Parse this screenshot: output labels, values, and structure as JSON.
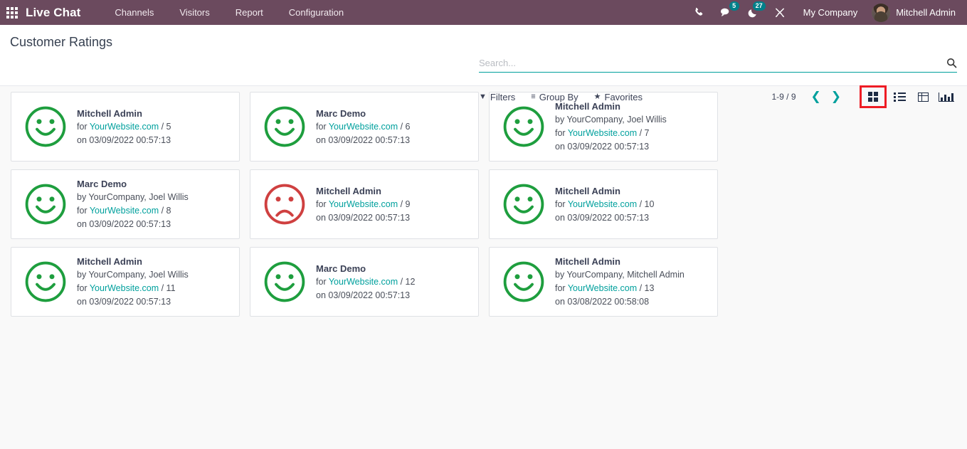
{
  "navbar": {
    "apps_icon": "apps-grid-icon",
    "brand": "Live Chat",
    "menu": [
      {
        "label": "Channels"
      },
      {
        "label": "Visitors"
      },
      {
        "label": "Report"
      },
      {
        "label": "Configuration"
      }
    ],
    "icons": [
      {
        "name": "phone-icon",
        "badge": ""
      },
      {
        "name": "messages-icon",
        "badge": "5"
      },
      {
        "name": "activities-icon",
        "badge": "27"
      },
      {
        "name": "debug-tools-icon",
        "badge": ""
      }
    ],
    "company": "My Company",
    "user": "Mitchell Admin",
    "colors": {
      "background": "#6b4a5e",
      "badge": "#00808a",
      "text": "#ffffff"
    }
  },
  "control_panel": {
    "title": "Customer Ratings",
    "search": {
      "value": "",
      "placeholder": "Search...",
      "icon": "search-icon"
    },
    "filters": [
      {
        "label": "Filters",
        "glyph": "▼"
      },
      {
        "label": "Group By",
        "glyph": "≡"
      },
      {
        "label": "Favorites",
        "glyph": "★"
      }
    ],
    "pager": {
      "value": "1-9 / 9",
      "prev": "❮",
      "next": "❯"
    },
    "views": [
      {
        "name": "kanban",
        "active": true
      },
      {
        "name": "list",
        "active": false
      },
      {
        "name": "pivot",
        "active": false
      },
      {
        "name": "graph",
        "active": false
      }
    ],
    "colors": {
      "accent": "#00A09D",
      "highlight": "#ee1c25"
    }
  },
  "kanban": {
    "cards": [
      {
        "rating": "happy",
        "name": "Mitchell Admin",
        "by": "",
        "for_prefix": "for",
        "for_link": "YourWebsite.com",
        "for_id": "/ 5",
        "on": "on 03/09/2022 00:57:13"
      },
      {
        "rating": "happy",
        "name": "Marc Demo",
        "by": "",
        "for_prefix": "for",
        "for_link": "YourWebsite.com",
        "for_id": "/ 6",
        "on": "on 03/09/2022 00:57:13"
      },
      {
        "rating": "happy",
        "name": "Mitchell Admin",
        "by": "by YourCompany, Joel Willis",
        "for_prefix": "for",
        "for_link": "YourWebsite.com",
        "for_id": "/ 7",
        "on": "on 03/09/2022 00:57:13"
      },
      {
        "rating": "happy",
        "name": "Marc Demo",
        "by": "by YourCompany, Joel Willis",
        "for_prefix": "for",
        "for_link": "YourWebsite.com",
        "for_id": "/ 8",
        "on": "on 03/09/2022 00:57:13"
      },
      {
        "rating": "sad",
        "name": "Mitchell Admin",
        "by": "",
        "for_prefix": "for",
        "for_link": "YourWebsite.com",
        "for_id": "/ 9",
        "on": "on 03/09/2022 00:57:13"
      },
      {
        "rating": "happy",
        "name": "Mitchell Admin",
        "by": "",
        "for_prefix": "for",
        "for_link": "YourWebsite.com",
        "for_id": "/ 10",
        "on": "on 03/09/2022 00:57:13"
      },
      {
        "rating": "happy",
        "name": "Mitchell Admin",
        "by": "by YourCompany, Joel Willis",
        "for_prefix": "for",
        "for_link": "YourWebsite.com",
        "for_id": "/ 11",
        "on": "on 03/09/2022 00:57:13"
      },
      {
        "rating": "happy",
        "name": "Marc Demo",
        "by": "",
        "for_prefix": "for",
        "for_link": "YourWebsite.com",
        "for_id": "/ 12",
        "on": "on 03/09/2022 00:57:13"
      },
      {
        "rating": "happy",
        "name": "Mitchell Admin",
        "by": "by YourCompany, Mitchell Admin",
        "for_prefix": "for",
        "for_link": "YourWebsite.com",
        "for_id": "/ 13",
        "on": "on 03/08/2022 00:58:08"
      }
    ],
    "colors": {
      "happy": "#1e9e3e",
      "sad": "#cf4040",
      "card_bg": "#ffffff",
      "board_bg": "#f9f9f9"
    }
  }
}
